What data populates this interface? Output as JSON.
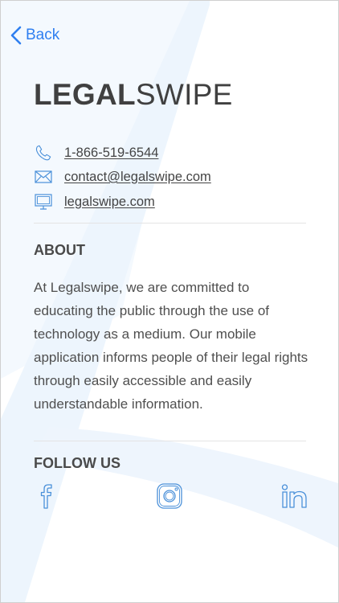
{
  "nav": {
    "back_label": "Back"
  },
  "brand": {
    "bold": "LEGAL",
    "light": "SWIPE"
  },
  "contact": {
    "phone": "1-866-519-6544",
    "email": "contact@legalswipe.com",
    "website": "legalswipe.com"
  },
  "about": {
    "title": "ABOUT",
    "body": "At Legalswipe, we are committed to educating the public through the use of technology as a medium. Our mobile application informs people of their legal rights through easily accessible and easily understandable information."
  },
  "follow": {
    "title": "FOLLOW US",
    "icons": [
      "facebook-icon",
      "instagram-icon",
      "linkedin-icon"
    ]
  },
  "colors": {
    "accent": "#2f7ff0",
    "icon_blue": "#4a90d9",
    "text": "#4a4a4a",
    "swoosh": "#eef5fd"
  }
}
